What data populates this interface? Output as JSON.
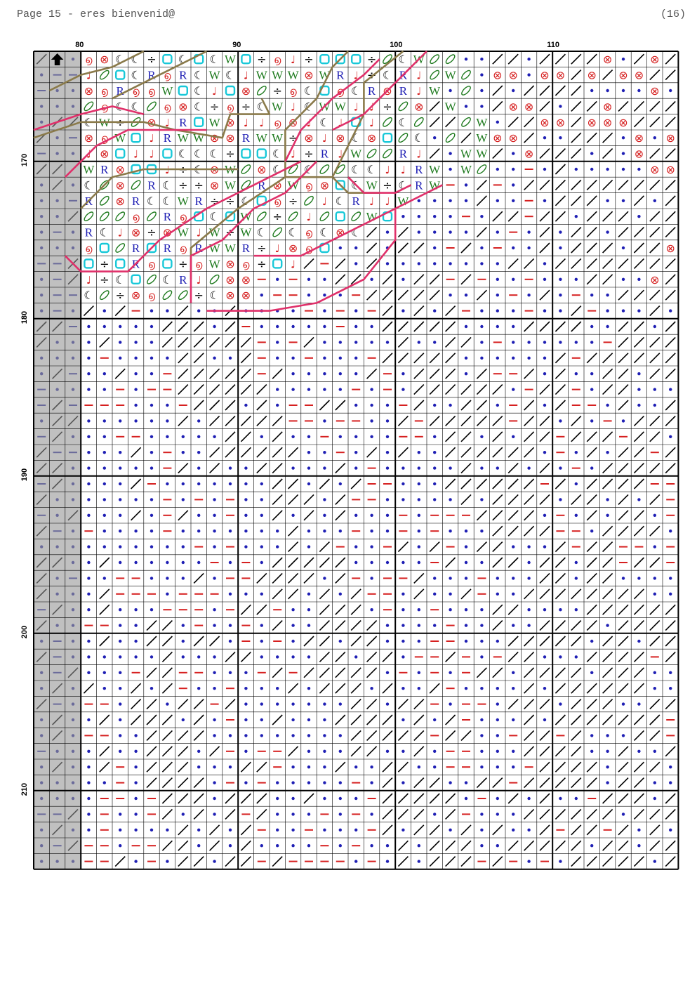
{
  "header": {
    "page": "Page 15",
    "title": "- eres bienvenid@",
    "total_pages": "(16)"
  },
  "grid": {
    "col_start": 77,
    "col_end": 117,
    "row_start": 163,
    "row_end": 214,
    "col_labels": [
      "80",
      "90",
      "100",
      "110"
    ],
    "row_labels": [
      "170",
      "180",
      "190",
      "200",
      "210"
    ],
    "shaded_cols": 3,
    "colors": {
      "background": "#ffffff",
      "shaded": "#c0c0c0",
      "grid_line": "#000000",
      "dot": "#1f1fb4",
      "dash": "#d62020",
      "slash": "#000000",
      "r": "#1f1fb4",
      "note": "#d62020",
      "w": "#1e7a1e",
      "spiral": "#d62020",
      "cyan": "#18c8d8",
      "xcircle": "#d62020",
      "pink_outline": "#e0306a",
      "brown_outline": "#8a7a4a"
    }
  },
  "legend_symbols": [
    "dot",
    "dash",
    "slash",
    "R",
    "÷",
    "note",
    "W",
    "oval",
    "spiral",
    "moon",
    "cyan-square",
    "x-circle"
  ],
  "start_marker": "arrow-up-icon"
}
